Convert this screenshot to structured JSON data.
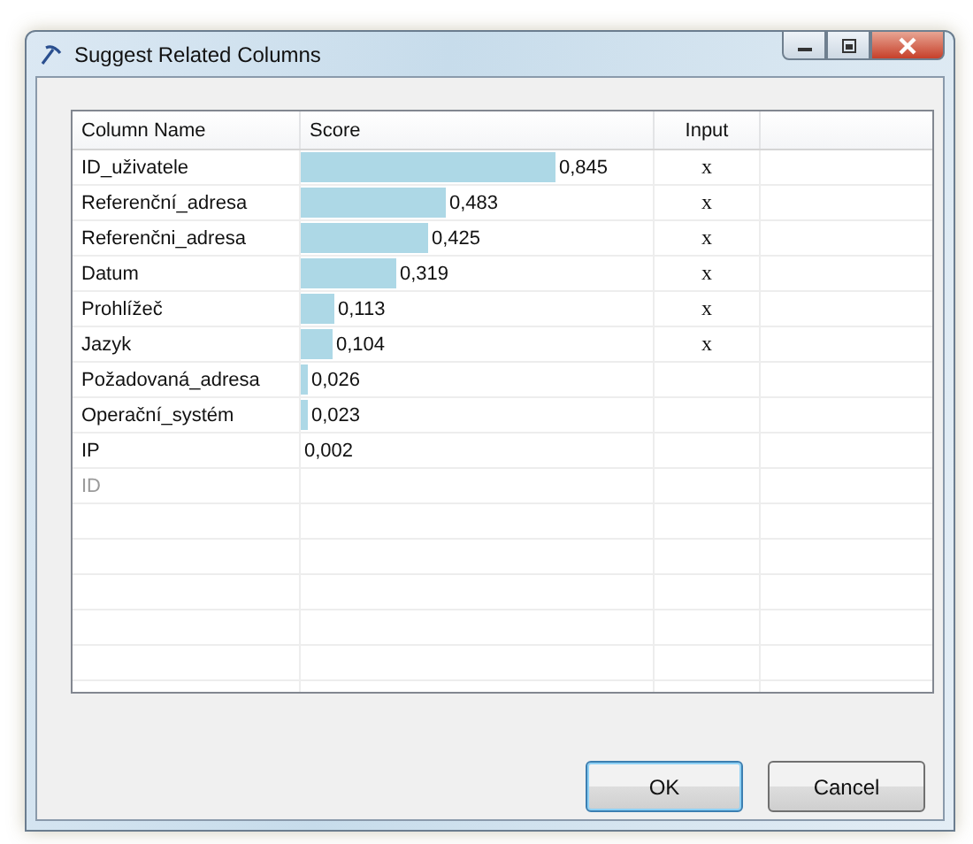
{
  "window": {
    "title": "Suggest Related Columns"
  },
  "table": {
    "columns": [
      "Column Name",
      "Score",
      "Input"
    ],
    "rows": [
      {
        "name": "ID_uživatele",
        "score": "0,845",
        "input": "x",
        "disabled": false
      },
      {
        "name": "Referenční_adresa",
        "score": "0,483",
        "input": "x",
        "disabled": false
      },
      {
        "name": "Referenčni_adresa",
        "score": "0,425",
        "input": "x",
        "disabled": false
      },
      {
        "name": "Datum",
        "score": "0,319",
        "input": "x",
        "disabled": false
      },
      {
        "name": "Prohlížeč",
        "score": "0,113",
        "input": "x",
        "disabled": false
      },
      {
        "name": "Jazyk",
        "score": "0,104",
        "input": "x",
        "disabled": false
      },
      {
        "name": "Požadovaná_adresa",
        "score": "0,026",
        "disabled": false
      },
      {
        "name": "Operační_systém",
        "score": "0,023",
        "disabled": false
      },
      {
        "name": "IP",
        "score": "0,002",
        "disabled": false
      },
      {
        "name": "ID",
        "disabled": true
      }
    ]
  },
  "buttons": [
    {
      "label": "OK",
      "focused": true
    },
    {
      "label": "Cancel",
      "focused": false
    }
  ]
}
